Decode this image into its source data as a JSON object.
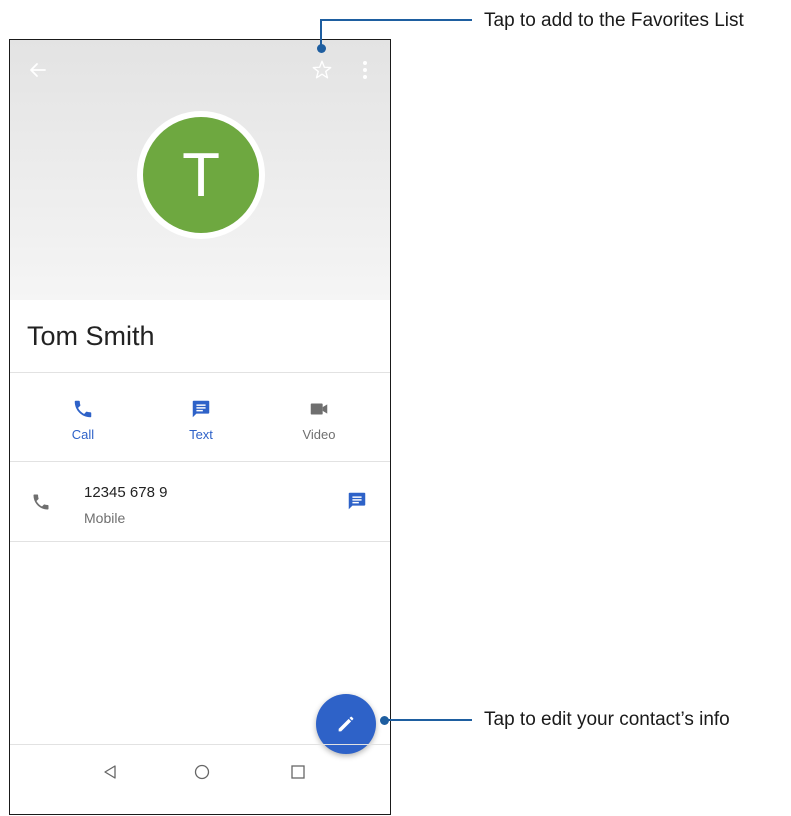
{
  "contact": {
    "initial": "T",
    "name": "Tom Smith",
    "avatar_color": "#6ea840"
  },
  "toolbar": {
    "back_icon": "arrow-left-icon",
    "favorite_icon": "star-outline-icon",
    "more_icon": "more-vert-icon"
  },
  "actions": [
    {
      "label": "Call",
      "icon": "phone-icon",
      "color": "#2e62c8"
    },
    {
      "label": "Text",
      "icon": "message-icon",
      "color": "#2e62c8"
    },
    {
      "label": "Video",
      "icon": "videocam-icon",
      "color": "#6f6f6f"
    }
  ],
  "phone_entry": {
    "number": "12345 678 9",
    "type": "Mobile"
  },
  "fab": {
    "icon": "pencil-icon",
    "color": "#2e62c8"
  },
  "navbar": [
    "back-triangle-icon",
    "home-circle-icon",
    "recents-square-icon"
  ],
  "callouts": {
    "favorites": "Tap to add to the Favorites List",
    "edit": "Tap to edit your contact’s info"
  },
  "colors": {
    "accent": "#2e62c8",
    "callout": "#1e5ea0"
  }
}
